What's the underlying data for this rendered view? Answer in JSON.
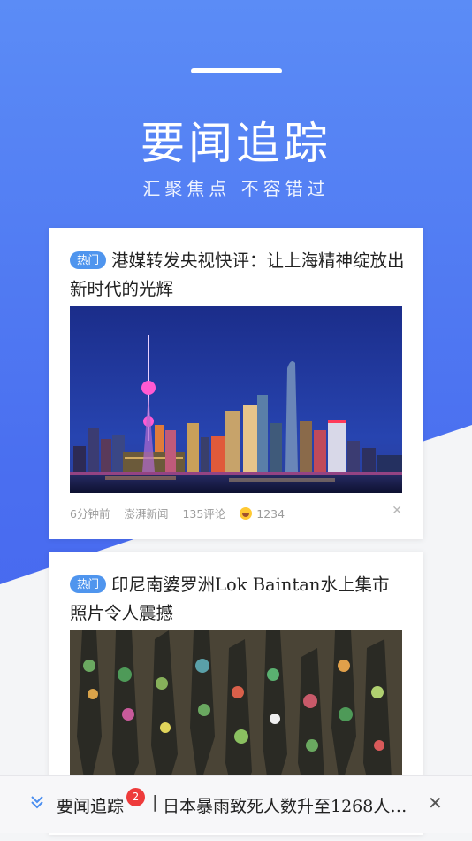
{
  "hero": {
    "title": "要闻追踪",
    "subtitle": "汇聚焦点  不容错过"
  },
  "cards": [
    {
      "tag": "热门",
      "headline": "港媒转发央视快评：让上海精神绽放出新时代的光辉",
      "image": "shanghai-skyline-night-photo",
      "time": "6分钟前",
      "source": "澎湃新闻",
      "comments": "135评论",
      "likes": "1234",
      "reaction_icon": "laugh-emoji-icon",
      "dismiss_icon": "close-icon"
    },
    {
      "tag": "热门",
      "headline": "印尼南婆罗洲Lok Baintan水上集市照片令人震撼",
      "image": "floating-market-boats-photo"
    }
  ],
  "bottom_bar": {
    "icon": "chevron-down-icon",
    "title": "要闻追踪",
    "badge": "2",
    "separator": "|",
    "text": "日本暴雨致死人数升至1268人…",
    "close": "✕"
  },
  "colors": {
    "hero": "#4a6ff0",
    "tag": "#4f95ee",
    "badge": "#ee3b3b"
  }
}
